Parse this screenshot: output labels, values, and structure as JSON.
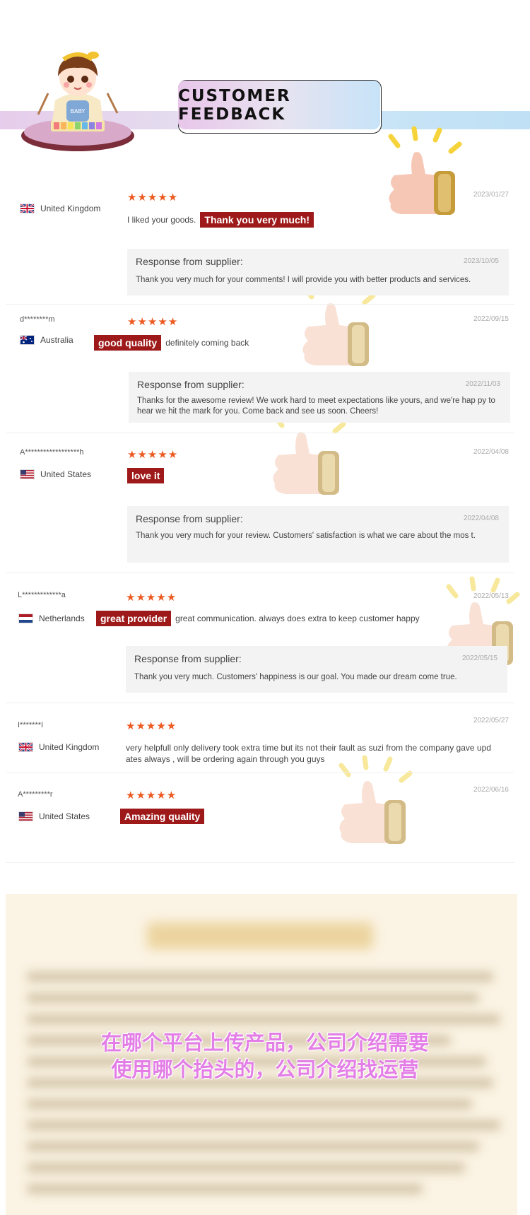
{
  "header": {
    "title": "CUSTOMER FEEDBACK",
    "mascot_label": "BABY"
  },
  "reviews": [
    {
      "user": "",
      "country": "United Kingdom",
      "flag": "uk",
      "stars": "★★★★★",
      "date": "2023/01/27",
      "comment_before": "I liked your goods.",
      "badge": "Thank you very much!",
      "comment_after": "",
      "response_title": "Response from supplier:",
      "response_date": "2023/10/05",
      "response_text": "Thank you very much for your comments! I will provide you with better products and services."
    },
    {
      "user": "d********m",
      "country": "Australia",
      "flag": "au",
      "stars": "★★★★★",
      "date": "2022/09/15",
      "comment_before": "",
      "badge": "good quality",
      "comment_after": "definitely coming back",
      "response_title": "Response from supplier:",
      "response_date": "2022/11/03",
      "response_text": "Thanks for the awesome review! We work hard to meet expectations like yours, and we're hap py to hear we hit the mark for you. Come back and see us soon. Cheers!"
    },
    {
      "user": "A******************h",
      "country": "United States",
      "flag": "us",
      "stars": "★★★★★",
      "date": "2022/04/08",
      "comment_before": "",
      "badge": "love it",
      "comment_after": "",
      "response_title": "Response from supplier:",
      "response_date": "2022/04/08",
      "response_text": "Thank you very much for your review. Customers' satisfaction is what we care about the mos t."
    },
    {
      "user": "L*************a",
      "country": "Netherlands",
      "flag": "nl",
      "stars": "★★★★★",
      "date": "2022/05/13",
      "comment_before": "",
      "badge": "great provider",
      "comment_after": "great communication. always does extra to keep customer happy",
      "response_title": "Response from supplier:",
      "response_date": "2022/05/15",
      "response_text": "Thank you very much. Customers' happiness is our goal. You made our dream come true."
    },
    {
      "user": "I*******I",
      "country": "United Kingdom",
      "flag": "uk",
      "stars": "★★★★★",
      "date": "2022/05/27",
      "comment_full": "very helpfull only delivery took extra time but its not their fault as suzi from the company gave upd ates always , will be ordering again through you guys"
    },
    {
      "user": "A*********r",
      "country": "United States",
      "flag": "us",
      "stars": "★★★★★",
      "date": "2022/06/16",
      "comment_before": "",
      "badge": "Amazing quality",
      "comment_after": ""
    }
  ],
  "overlay": {
    "line1": "在哪个平台上传产品，公司介绍需要",
    "line2": "使用哪个抬头的，公司介绍找运营"
  },
  "colors": {
    "badge": "#9e1a1a",
    "stars": "#ec5a21",
    "overlay_text": "#e37ee6"
  }
}
